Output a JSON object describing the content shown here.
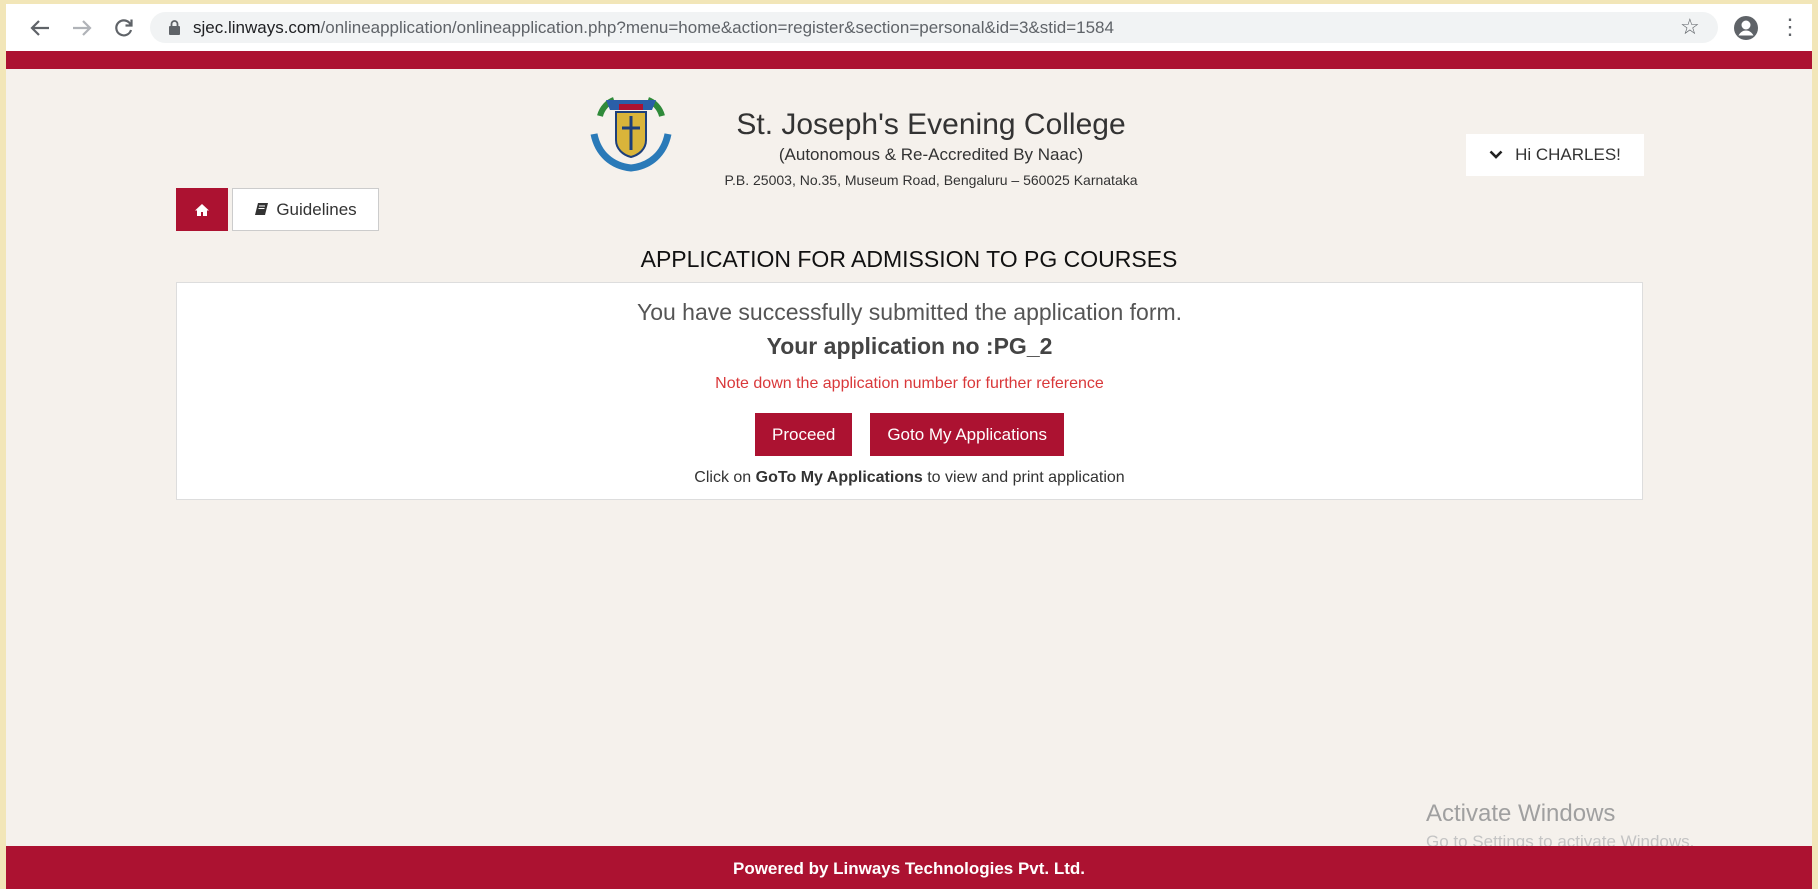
{
  "browser": {
    "url_host": "sjec.linways.com",
    "url_path": "/onlineapplication/onlineapplication.php?menu=home&action=register&section=personal&id=3&stid=1584"
  },
  "header": {
    "college_name": "St. Joseph's Evening College",
    "subtitle": "(Autonomous & Re-Accredited By Naac)",
    "address": "P.B. 25003, No.35, Museum Road, Bengaluru – 560025 Karnataka",
    "user_greeting": "Hi CHARLES!"
  },
  "nav": {
    "guidelines_label": "Guidelines"
  },
  "page": {
    "heading": "APPLICATION FOR ADMISSION TO PG COURSES"
  },
  "panel": {
    "success_message": "You have successfully submitted the application form.",
    "application_no_text": "Your application no :PG_2",
    "note": "Note down the application number for further reference",
    "proceed_label": "Proceed",
    "goto_label": "Goto My Applications",
    "hint_prefix": "Click on ",
    "hint_goto": "GoTo",
    "hint_space": " ",
    "hint_apps": "My Applications",
    "hint_suffix": " to view and print application"
  },
  "watermark": {
    "title": "Activate Windows",
    "subtitle": "Go to Settings to activate Windows."
  },
  "footer": {
    "text": "Powered by Linways Technologies Pvt. Ltd."
  },
  "colors": {
    "brand": "#ac1231",
    "note": "#d9383a",
    "background": "#f5f1ec"
  },
  "icons": {
    "back": "arrow-left-icon",
    "forward": "arrow-right-icon",
    "reload": "reload-icon",
    "lock": "lock-icon",
    "bookmark": "star-icon",
    "account": "account-icon",
    "menu": "kebab-menu-icon",
    "logo": "college-crest",
    "user_menu": "chevron-down-icon",
    "home": "home-icon",
    "guidelines": "book-icon"
  }
}
